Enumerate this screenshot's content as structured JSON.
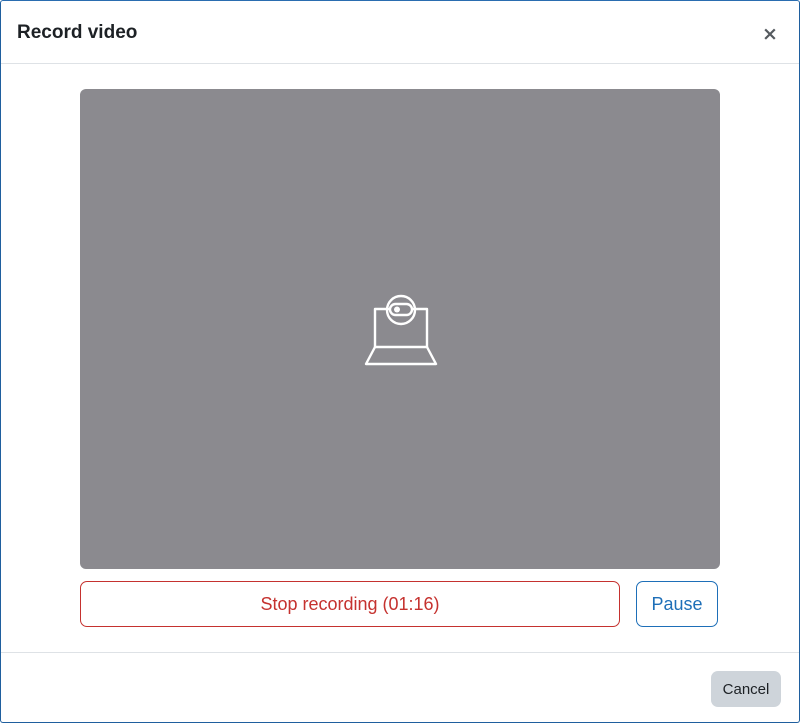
{
  "dialog": {
    "title": "Record video",
    "close_label": "×"
  },
  "video": {
    "placeholder_icon": "webcam-icon",
    "background_color": "#8b8a8f"
  },
  "controls": {
    "stop_label": "Stop recording (01:16)",
    "pause_label": "Pause",
    "stop_color": "#c5322f",
    "pause_color": "#1e6fb8"
  },
  "footer": {
    "cancel_label": "Cancel"
  }
}
